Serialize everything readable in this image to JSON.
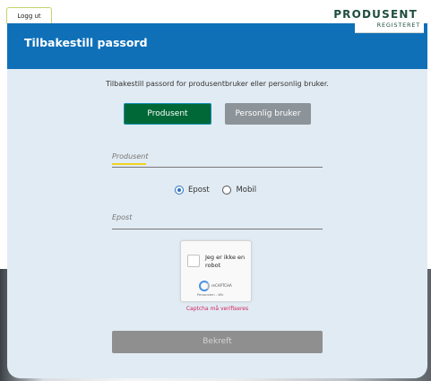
{
  "header": {
    "logout_label": "Logg ut",
    "brand_name": "PRODUSENT",
    "brand_sub": "REGISTERET"
  },
  "card": {
    "title": "Tilbakestill passord",
    "intro": "Tilbakestill passord for produsentbruker eller personlig bruker.",
    "user_type": {
      "options": [
        "Produsent",
        "Personlig bruker"
      ],
      "selected": "Produsent"
    },
    "producer_field": {
      "placeholder": "Produsent",
      "value": ""
    },
    "contact_method": {
      "options": [
        "Epost",
        "Mobil"
      ],
      "selected": "Epost"
    },
    "email_field": {
      "placeholder": "Epost",
      "value": ""
    },
    "captcha": {
      "label": "Jeg er ikke en robot",
      "brand": "reCAPTCHA",
      "links": "Personvern - Vilk",
      "error": "Captcha må verifiseres"
    },
    "submit_label": "Bekreft"
  },
  "colors": {
    "header_blue": "#0f70b8",
    "brand_green": "#1f4e3d",
    "active_green": "#006837",
    "inactive_grey": "#8d9499",
    "field_accent": "#f2d11f",
    "error": "#d0245e"
  },
  "icons": [
    "radio-checked-icon",
    "radio-unchecked-icon",
    "recaptcha-logo-icon",
    "checkbox-icon"
  ]
}
